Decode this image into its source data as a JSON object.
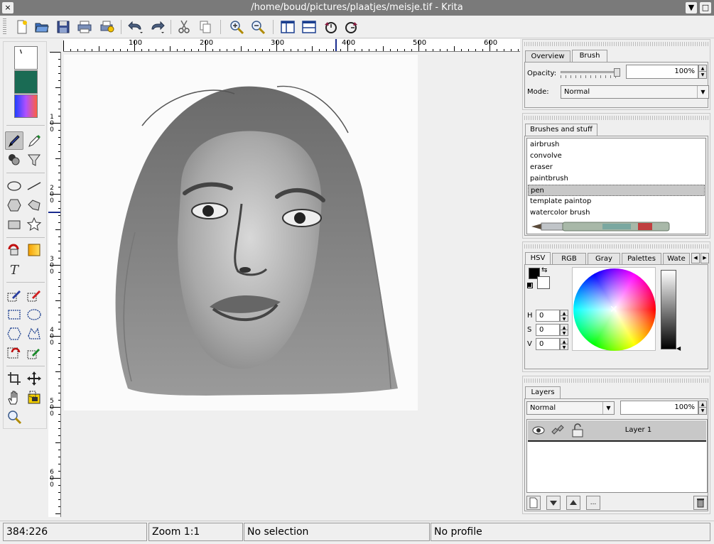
{
  "window": {
    "title": "/home/boud/pictures/plaatjes/meisje.tif - Krita",
    "close_glyph": "×",
    "menu_glyph": "▼",
    "max_glyph": "□"
  },
  "toolbar": {
    "buttons": [
      {
        "name": "new-document-icon"
      },
      {
        "name": "open-document-icon"
      },
      {
        "name": "save-icon"
      },
      {
        "name": "print-icon"
      },
      {
        "name": "print-preview-icon"
      },
      {
        "name": "undo-icon"
      },
      {
        "name": "redo-icon"
      },
      {
        "name": "cut-icon"
      },
      {
        "name": "copy-icon"
      },
      {
        "name": "zoom-in-icon"
      },
      {
        "name": "zoom-out-icon"
      },
      {
        "name": "vertical-split-icon"
      },
      {
        "name": "horizontal-split-icon"
      },
      {
        "name": "rotate-left-icon"
      },
      {
        "name": "rotate-right-icon"
      }
    ]
  },
  "rulers": {
    "horizontal_labels": [
      "100",
      "200",
      "300",
      "400",
      "500",
      "600"
    ],
    "vertical_labels": [
      "100",
      "200",
      "300",
      "400",
      "500",
      "600"
    ]
  },
  "tool_options_dock": {
    "tabs": [
      "Overview",
      "Brush"
    ],
    "active_tab": "Brush",
    "opacity_label": "Opacity:",
    "opacity_value": "100%",
    "mode_label": "Mode:",
    "mode_value": "Normal"
  },
  "brushes_dock": {
    "tab": "Brushes and stuff",
    "items": [
      "airbrush",
      "convolve",
      "eraser",
      "paintbrush",
      "pen",
      "template paintop",
      "watercolor brush"
    ],
    "selected": "pen"
  },
  "color_dock": {
    "tabs": [
      "HSV",
      "RGB",
      "Gray",
      "Palettes",
      "Wate"
    ],
    "active_tab": "HSV",
    "h_label": "H",
    "s_label": "S",
    "v_label": "V",
    "h_value": "0",
    "s_value": "0",
    "v_value": "0"
  },
  "layers_dock": {
    "tab": "Layers",
    "mode_value": "Normal",
    "opacity_value": "100%",
    "layer_name": "Layer 1",
    "more_label": "..."
  },
  "statusbar": {
    "coordinates": "384:226",
    "zoom": "Zoom 1:1",
    "selection": "No selection",
    "profile": "No profile"
  },
  "colors": {
    "titlebar": "#7a7a7a",
    "background_swatch": "#1a6b54",
    "selected_row": "#c8c8c8",
    "ruler_marker": "#1b2d8f"
  }
}
